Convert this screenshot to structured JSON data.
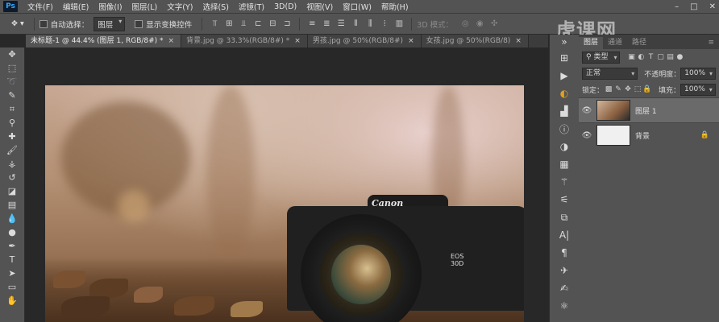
{
  "app": {
    "logo": "Ps"
  },
  "menu": [
    "文件(F)",
    "编辑(E)",
    "图像(I)",
    "图层(L)",
    "文字(Y)",
    "选择(S)",
    "滤镜(T)",
    "3D(D)",
    "视图(V)",
    "窗口(W)",
    "帮助(H)"
  ],
  "window_controls": {
    "minimize": "–",
    "restore": "□",
    "close": "✕"
  },
  "options": {
    "auto_select_label": "自动选择：",
    "auto_select_value": "图层",
    "show_transform_label": "显示变换控件",
    "mode_3d_label": "3D 模式："
  },
  "tabs": [
    {
      "label": "未标题-1 @ 44.4% (图层 1, RGB/8#) *",
      "close": "×"
    },
    {
      "label": "背景.jpg @ 33.3%(RGB/8#) *",
      "close": "×"
    },
    {
      "label": "男孩.jpg @ 50%(RGB/8#)",
      "close": "×"
    },
    {
      "label": "女孩.jpg @ 50%(RGB/8)",
      "close": "×"
    }
  ],
  "photo": {
    "brand": "Canon",
    "model_line1": "EOS",
    "model_line2": "30D"
  },
  "watermark": "虎课网",
  "layers_panel": {
    "tabs": [
      "图层",
      "通道",
      "路径"
    ],
    "filter_label": "类型",
    "blend_mode": "正常",
    "opacity_label": "不透明度：",
    "opacity_value": "100%",
    "lock_label": "锁定：",
    "fill_label": "填充：",
    "fill_value": "100%",
    "layers": [
      {
        "name": "图层 1",
        "visible": true,
        "active": true
      },
      {
        "name": "背景",
        "visible": true,
        "active": false,
        "locked": true
      }
    ]
  },
  "icons": {
    "eye": "eye-icon",
    "lock": "lock-icon"
  }
}
